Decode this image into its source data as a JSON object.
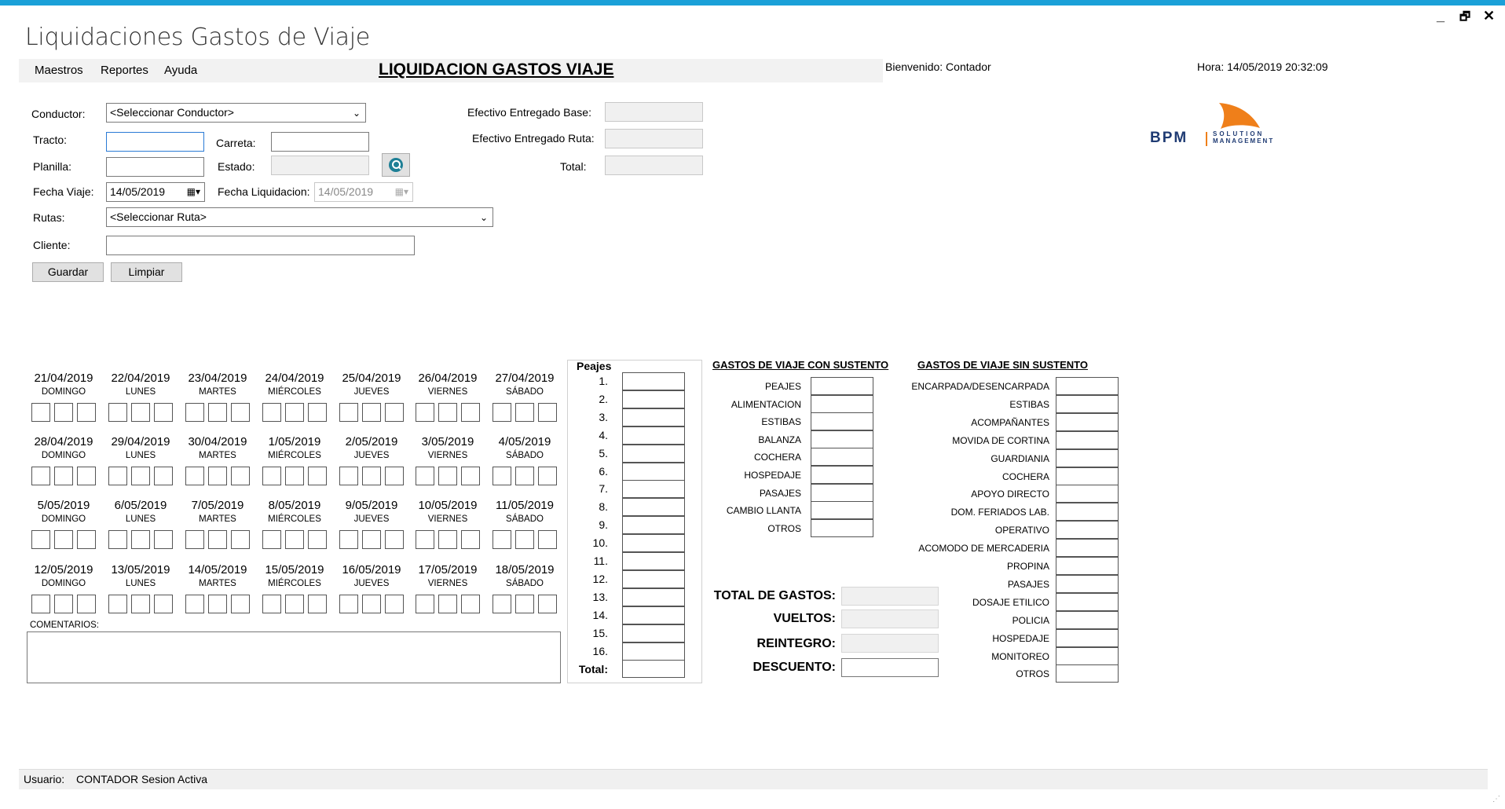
{
  "window": {
    "title": "Liquidaciones Gastos de Viaje",
    "minimize": "_",
    "restore": "🗗",
    "close": "✕"
  },
  "menu": {
    "items": [
      "Maestros",
      "Reportes",
      "Ayuda"
    ]
  },
  "header": {
    "title": "LIQUIDACION GASTOS VIAJE",
    "welcome": "Bienvenido: Contador",
    "hora": "Hora: 14/05/2019 20:32:09"
  },
  "logo": {
    "brand": "BPM",
    "line1": "SOLUTION",
    "line2": "MANAGEMENT",
    "color": "#ef7f1a",
    "text_color": "#1f3b73"
  },
  "form": {
    "conductor": {
      "label": "Conductor:",
      "value": "<Seleccionar Conductor>"
    },
    "tracto": {
      "label": "Tracto:",
      "value": ""
    },
    "carreta": {
      "label": "Carreta:",
      "value": ""
    },
    "planilla": {
      "label": "Planilla:",
      "value": ""
    },
    "estado": {
      "label": "Estado:",
      "value": ""
    },
    "fecha_viaje": {
      "label": "Fecha Viaje:",
      "value": "14/05/2019"
    },
    "fecha_liquidacion": {
      "label": "Fecha Liquidacion:",
      "value": "14/05/2019"
    },
    "rutas": {
      "label": "Rutas:",
      "value": "<Seleccionar Ruta>"
    },
    "cliente": {
      "label": "Cliente:",
      "value": ""
    },
    "efectivo_base": {
      "label": "Efectivo Entregado Base:",
      "value": ""
    },
    "efectivo_ruta": {
      "label": "Efectivo Entregado Ruta:",
      "value": ""
    },
    "total": {
      "label": "Total:",
      "value": ""
    },
    "guardar": "Guardar",
    "limpiar": "Limpiar"
  },
  "calendar": {
    "days": [
      "DOMINGO",
      "LUNES",
      "MARTES",
      "MIÉRCOLES",
      "JUEVES",
      "VIERNES",
      "SÁBADO"
    ],
    "weeks": [
      [
        "21/04/2019",
        "22/04/2019",
        "23/04/2019",
        "24/04/2019",
        "25/04/2019",
        "26/04/2019",
        "27/04/2019"
      ],
      [
        "28/04/2019",
        "29/04/2019",
        "30/04/2019",
        "1/05/2019",
        "2/05/2019",
        "3/05/2019",
        "4/05/2019"
      ],
      [
        "5/05/2019",
        "6/05/2019",
        "7/05/2019",
        "8/05/2019",
        "9/05/2019",
        "10/05/2019",
        "11/05/2019"
      ],
      [
        "12/05/2019",
        "13/05/2019",
        "14/05/2019",
        "15/05/2019",
        "16/05/2019",
        "17/05/2019",
        "18/05/2019"
      ]
    ]
  },
  "comentarios": {
    "label": "COMENTARIOS:",
    "value": ""
  },
  "peajes": {
    "title": "Peajes",
    "rows": [
      "1.",
      "2.",
      "3.",
      "4.",
      "5.",
      "6.",
      "7.",
      "8.",
      "9.",
      "10.",
      "11.",
      "12.",
      "13.",
      "14.",
      "15.",
      "16."
    ],
    "total_label": "Total:"
  },
  "con_sustento": {
    "title": "GASTOS DE VIAJE CON SUSTENTO",
    "items": [
      "PEAJES",
      "ALIMENTACION",
      "ESTIBAS",
      "BALANZA",
      "COCHERA",
      "HOSPEDAJE",
      "PASAJES",
      "CAMBIO LLANTA",
      "OTROS"
    ]
  },
  "sin_sustento": {
    "title": "GASTOS DE VIAJE SIN SUSTENTO",
    "items": [
      "ENCARPADA/DESENCARPADA",
      "ESTIBAS",
      "ACOMPAÑANTES",
      "MOVIDA DE CORTINA",
      "GUARDIANIA",
      "COCHERA",
      "APOYO DIRECTO",
      "DOM. FERIADOS LAB.",
      "OPERATIVO",
      "ACOMODO DE MERCADERIA",
      "PROPINA",
      "PASAJES",
      "DOSAJE ETILICO",
      "POLICIA",
      "HOSPEDAJE",
      "MONITOREO",
      "OTROS"
    ]
  },
  "totales": {
    "total_gastos": "TOTAL DE GASTOS:",
    "vueltos": "VUELTOS:",
    "reintegro": "REINTEGRO:",
    "descuento": "DESCUENTO:"
  },
  "status": {
    "usuario_label": "Usuario:",
    "usuario_value": "CONTADOR Sesion Activa"
  },
  "colors": {
    "accent": "#1aa0d8",
    "search": "#1d7f95"
  }
}
